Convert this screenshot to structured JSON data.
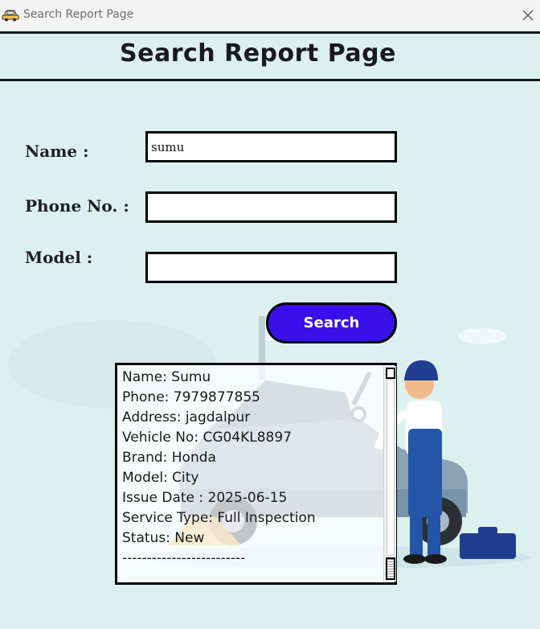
{
  "window": {
    "title": "Search Report Page",
    "app_icon": "car-icon",
    "close_icon": "close-icon"
  },
  "header": {
    "title": "Search Report Page"
  },
  "form": {
    "name_label": "Name   :",
    "name_value": "sumu",
    "phone_label": "Phone No. :",
    "phone_value": "",
    "model_label": "Model :",
    "model_value": "",
    "search_button": "Search"
  },
  "result": {
    "lines": [
      "Name: Sumu",
      "Phone: 7979877855",
      "Address: jagdalpur",
      "Vehicle No: CG04KL8897",
      "Brand: Honda",
      "Model: City",
      "Issue Date : 2025-06-15",
      "Service Type: Full Inspection",
      "Status: New",
      "-------------------------"
    ]
  },
  "colors": {
    "background": "#ddf0f0",
    "search_button": "#3a10ea",
    "title_bar": "#f3f3f3"
  }
}
